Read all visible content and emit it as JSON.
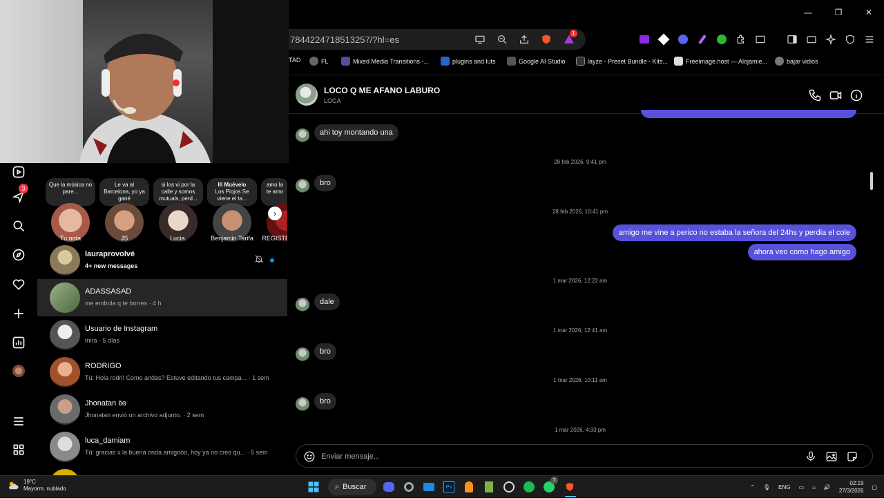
{
  "browser": {
    "url": "7844224718513257/?hl=es",
    "tab_badge": "1",
    "bookmarks": [
      {
        "label": "TAD",
        "color": "#444"
      },
      {
        "label": "FL",
        "color": "#666"
      },
      {
        "label": "Mixed Media Transitions -...",
        "color": "#5c4a9c"
      },
      {
        "label": "plugins and luts",
        "color": "#2a62c9"
      },
      {
        "label": "Google AI Studio",
        "color": "#555"
      },
      {
        "label": "layze - Preset Bundle - Kits...",
        "color": "#333"
      },
      {
        "label": "Freeimage.host — Alojamie...",
        "color": "#ddd"
      },
      {
        "label": "bajar vidios",
        "color": "#777"
      }
    ]
  },
  "instagram": {
    "notifications_badge": "3",
    "notes": [
      {
        "lines": "Que la música no pare...",
        "name": "Tu nota"
      },
      {
        "lines": "Le va al Barcelona, yo ya gané",
        "name": "JS"
      },
      {
        "lines": "si los vi por la calle y somos mutuals, perd...",
        "name": "Lucia."
      },
      {
        "bold": "Ill Muévelo",
        "lines": "Los Piojos Se viene el ta...",
        "name": "Benjamin Tarifa"
      },
      {
        "lines": "amo la te amo",
        "name": "REGISTEF"
      }
    ],
    "threads": [
      {
        "name": "lauraprovolvé",
        "preview": "4+ new messages",
        "unread": true,
        "muted": true,
        "color": "#8a7a5a"
      },
      {
        "name": "ADASSASAD",
        "preview": "me embola q te borres · 4 h",
        "selected": true,
        "color": "#7a8c6a"
      },
      {
        "name": "Usuario de Instagram",
        "preview": "mira · 5 días",
        "color": "#5a5a5a"
      },
      {
        "name": "RODRIGO",
        "preview": "Tú: Hola rodri! Como andas? Estuve editando tus campa...  · 1 sem",
        "color": "#a0522d"
      },
      {
        "name": "Jhonatan ʚ̈ɞ",
        "preview": "Jhonatan envió un archivo adjunto. · 2 sem",
        "color": "#6a6a6a"
      },
      {
        "name": "luca_damiam",
        "preview": "Tú: gracias x la buena onda amigooo, hoy ya no creo qu...  · 5 sem",
        "color": "#8a8a8a"
      }
    ]
  },
  "chat": {
    "name": "LOCO Q ME AFANO LABURO",
    "username": "LOCA",
    "composer_placeholder": "Enviar mensaje...",
    "messages": {
      "m1": "ahi toy montando una",
      "t1": "28 feb 2026, 9:41 pm",
      "m2": "bro",
      "t2": "28 feb 2026, 10:41 pm",
      "o1": "amigo me vine a perico no estaba la señora del 24hs y perdia el cole",
      "o2": "ahora veo como hago amigo",
      "t3": "1 mar 2026, 12:22 am",
      "m3": "dale",
      "t4": "1 mar 2026, 12:41 am",
      "m4": "bro",
      "t5": "1 mar 2026, 10:11 am",
      "m5": "bro",
      "t6": "1 mar 2026, 4:33 pm"
    }
  },
  "taskbar": {
    "temp": "19°C",
    "weather": "Mayorm. nublado",
    "search": "Buscar",
    "whatsapp_badge": "7",
    "lang": "ENG",
    "time": "02:19",
    "date": "27/3/2026"
  },
  "colors": {
    "outgoing_bubble": "#5851db",
    "incoming_bubble": "#262626",
    "unread_dot": "#0095f6"
  }
}
